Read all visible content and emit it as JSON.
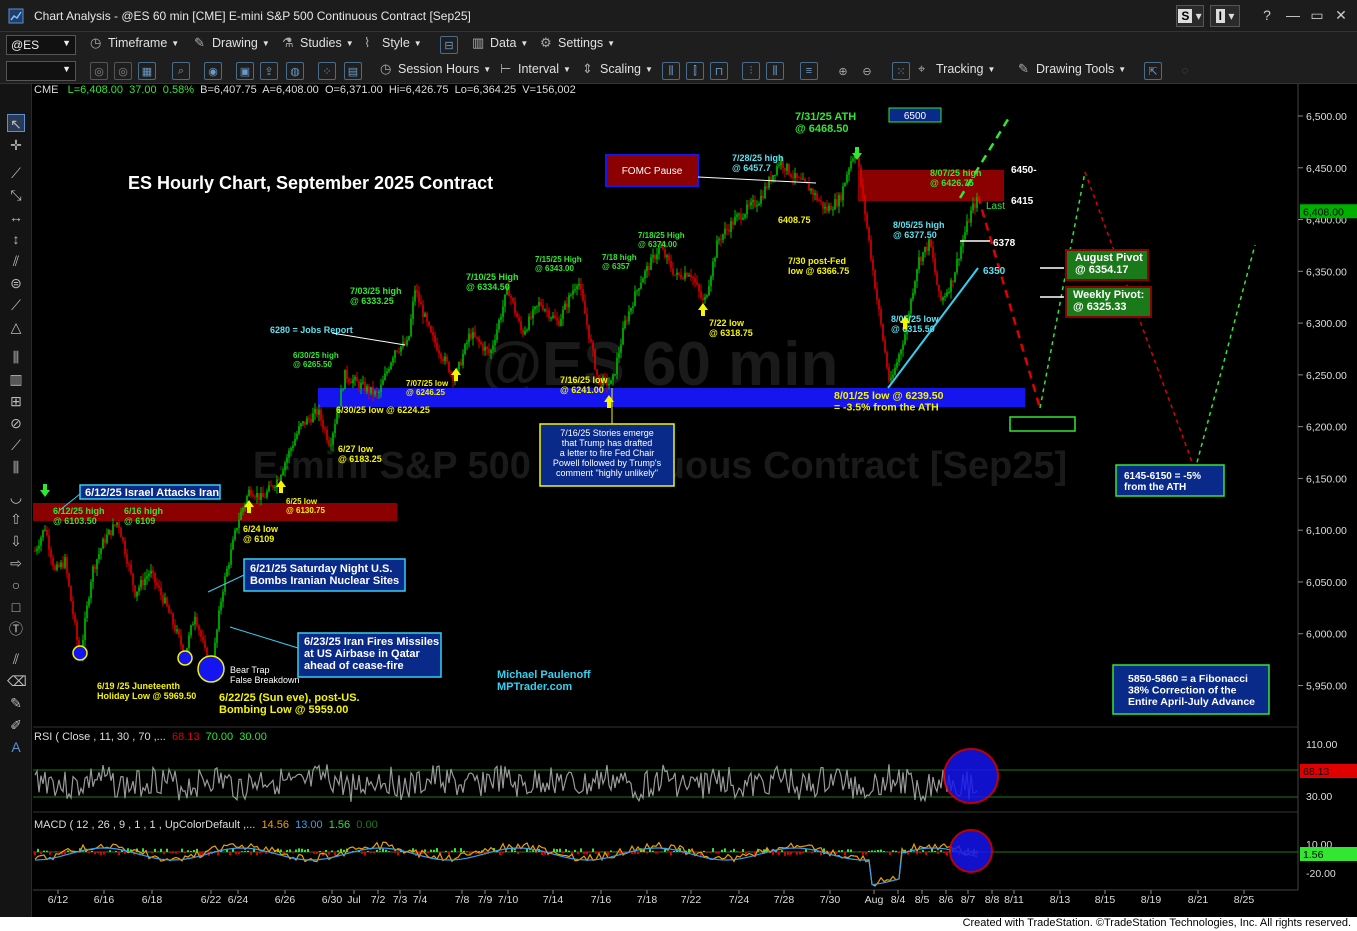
{
  "window": {
    "title": "Chart Analysis - @ES 60 min [CME] E-mini S&P 500 Continuous Contract [Sep25]",
    "s_button": "S",
    "i_button": "I"
  },
  "toolbar": {
    "symbol": "@ES",
    "items": [
      "Timeframe",
      "Drawing",
      "Studies",
      "Style",
      "Data",
      "Settings"
    ],
    "items2": [
      "Session Hours",
      "Interval",
      "Scaling",
      "Tracking",
      "Drawing Tools"
    ]
  },
  "infobar": {
    "exchange": "CME",
    "last": "L=6,408.00",
    "change": "37.00",
    "pct": "0.58%",
    "bid": "B=6,407.75",
    "ask": "A=6,408.00",
    "open": "O=6,371.00",
    "high": "Hi=6,426.75",
    "low": "Lo=6,364.25",
    "volume": "V=156,002"
  },
  "watermark": {
    "line1": "@ES 60 min",
    "line2": "E-mini S&P 500 Continuous Contract [Sep25]"
  },
  "colors": {
    "up": "#00c000",
    "down": "#e00000",
    "annotation_green": "#32e632",
    "annotation_yellow": "#f5f500",
    "annotation_cyan": "#5ce1f0",
    "support_band": "#1515f0",
    "resistance_band": "#8b0000",
    "box_blue": "#0a2a8a"
  },
  "chart_data": {
    "type": "line",
    "title": "ES Hourly Chart, September 2025 Contract",
    "xlabel": "",
    "ylabel": "",
    "ylim": [
      5915,
      6530
    ],
    "grid": false,
    "x": [
      "6/12",
      "6/13",
      "6/16",
      "6/17",
      "6/18",
      "6/19",
      "6/20",
      "6/22",
      "6/23",
      "6/24",
      "6/25",
      "6/26",
      "6/27",
      "6/30",
      "7/01",
      "7/02",
      "7/03",
      "7/07",
      "7/08",
      "7/09",
      "7/10",
      "7/11",
      "7/14",
      "7/15",
      "7/16",
      "7/17",
      "7/18",
      "7/21",
      "7/22",
      "7/23",
      "7/24",
      "7/25",
      "7/28",
      "7/29",
      "7/30",
      "7/31",
      "8/01",
      "8/04",
      "8/05",
      "8/06",
      "8/07"
    ],
    "series": [
      {
        "values": [
          6103,
          6040,
          6109,
          6060,
          6045,
          5975,
          5995,
          5959,
          6030,
          6109,
          6130,
          6150,
          6183,
          6224,
          6250,
          6280,
          6333,
          6246,
          6275,
          6290,
          6335,
          6300,
          6310,
          6343,
          6241,
          6320,
          6374,
          6345,
          6318,
          6390,
          6410,
          6430,
          6457,
          6420,
          6366,
          6468,
          6239,
          6320,
          6378,
          6315,
          6408
        ]
      }
    ],
    "price_axis_ticks": [
      "6,500.00",
      "6,450.00",
      "6,400.00",
      "6,350.00",
      "6,300.00",
      "6,250.00",
      "6,200.00",
      "6,150.00",
      "6,100.00",
      "6,050.00",
      "6,000.00",
      "5,950.00"
    ],
    "last_price_label": "6,408.00",
    "date_axis_ticks": [
      "6/12",
      "6/16",
      "6/18",
      "6/22",
      "6/24",
      "6/26",
      "6/30",
      "Jul",
      "7/2",
      "7/3",
      "7/4",
      "7/8",
      "7/9",
      "7/10",
      "7/14",
      "7/16",
      "7/18",
      "7/22",
      "7/24",
      "7/28",
      "7/30",
      "Aug",
      "8/4",
      "8/5",
      "8/6",
      "8/7",
      "8/8",
      "8/11",
      "8/13",
      "8/15",
      "8/19",
      "8/21",
      "8/25"
    ],
    "price_lines": [
      {
        "label": "6450-",
        "value": 6450
      },
      {
        "label": "6415",
        "value": 6415
      },
      {
        "label": "Last",
        "value": 6400
      },
      {
        "label": "6378",
        "value": 6378
      },
      {
        "label": "6350",
        "value": 6350
      }
    ],
    "annotations": {
      "ath": "7/31/25 ATH\n@ 6468.50",
      "box_6500": "6500",
      "fomc": "FOMC Pause",
      "high_0728": "7/28/25 high\n@ 6457.7",
      "low_6408": "6408.75",
      "high_0807": "8/07/25 high\n@ 6426.75",
      "high_0805": "8/05/25 high\n@ 6377.50",
      "postfed": "7/30 post-Fed\nlow @ 6366.75",
      "aug_pivot": "August Pivot\n@ 6354.17",
      "weekly_pivot": "Weekly Pivot:\n@ 6325.33",
      "low_0805": "8/05/25 low\n@ 6315.50",
      "low_0801": "8/01/25 low @ 6239.50\n= -3.5% from the ATH",
      "low_0722": "7/22 low\n@ 6318.75",
      "high_0718": "7/18/25 High\n@ 6374.00",
      "high_0718b": "7/18 high\n@ 6357",
      "high_0715": "7/15/25 High\n@ 6343.00",
      "high_0710": "7/10/25 High\n@ 6334.50",
      "high_0703": "7/03/25 high\n@ 6333.25",
      "jobs": "6280 = Jobs Report",
      "high_0630": "6/30/25 high\n@ 6265.50",
      "low_0707": "7/07/25 low\n@ 6246.25",
      "low_0716": "7/16/25 low\n@ 6241.00",
      "low_0630": "6/30/25 low @ 6224.25",
      "low_0627": "6/27 low\n@ 6183.25",
      "fed_story": "7/16/25 Stories emerge\nthat Trump has drafted\na letter to fire Fed Chair\nPowell followed by Trump's\ncomment \"highly unlikely\"",
      "low_0625": "6/25 low\n@ 6130.75",
      "low_0624": "6/24 low\n@ 6109",
      "israel": "6/12/25 Israel Attacks Iran",
      "high_0612": "6/12/25 high\n@ 6103.50",
      "high_0616": "6/16 high\n@ 6109",
      "saturday": "6/21/25 Saturday Night U.S.\nBombs Iranian Nuclear Sites",
      "missiles": "6/23/25 Iran Fires Missiles\nat US Airbase in Qatar\nahead of cease-fire",
      "bear_trap": "Bear Trap\nFalse Breakdown",
      "juneteenth": "6/19 /25 Juneteenth\nHoliday Low  @ 5969.50",
      "bombing_low": "6/22/25 (Sun eve), post-US.\nBombing Low @ 5959.00",
      "author": "Michael Paulenoff\nMPTrader.com",
      "fib": "5850-5860 = a Fibonacci\n38% Correction of the\nEntire April-July Advance",
      "minus5": "6145-6150 = -5%\nfrom the ATH"
    }
  },
  "rsi": {
    "label": "RSI ( Close , 11, 30 , 70 ,...",
    "v1": "68.13",
    "v2": "70.00",
    "v3": "30.00",
    "ticks": [
      "110.00",
      "30.00"
    ],
    "current": "68.13"
  },
  "macd": {
    "label": "MACD ( 12 , 26 , 9 , 1 , 1 , UpColorDefault ,...",
    "v1": "14.56",
    "v2": "13.00",
    "v3": "1.56",
    "v4": "0.00",
    "ticks": [
      "10.00",
      "-20.00"
    ],
    "current": "1.56"
  },
  "footer": "Created with TradeStation. ©TradeStation Technologies, Inc. All rights reserved."
}
